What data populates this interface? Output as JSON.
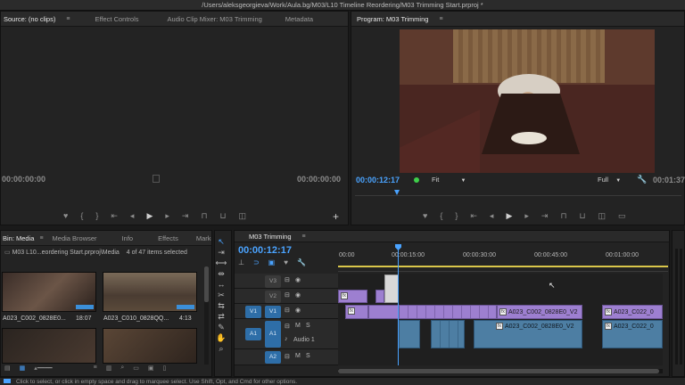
{
  "window": {
    "title": "/Users/aleksgeorgieva/Work/Aula.bg/M03/L10 Timeline Reordering/M03 Trimming Start.prproj *"
  },
  "source_panel": {
    "tabs": [
      "Source: (no clips)",
      "Effect Controls",
      "Audio Clip Mixer: M03 Trimming",
      "Metadata"
    ],
    "timecode_left": "00:00:00:00",
    "timecode_right": "00:00:00:00"
  },
  "program_panel": {
    "tab": "Program: M03 Trimming",
    "timecode": "00:00:12:17",
    "fit_label": "Fit",
    "full_label": "Full",
    "timecode_right": "00:01:37"
  },
  "project_panel": {
    "tabs": [
      "Bin: Media",
      "Media Browser",
      "Info",
      "Effects",
      "Marke"
    ],
    "path": "M03 L10...eordering Start.prproj\\Media",
    "selection_info": "4 of 47 items selected",
    "clips": [
      {
        "name": "A023_C002_0828E0...",
        "duration": "18:07"
      },
      {
        "name": "A023_C010_0828QQ...",
        "duration": "4:13"
      }
    ]
  },
  "timeline": {
    "tab": "M03 Trimming",
    "timecode": "00:00:12:17",
    "ruler": [
      "00:00",
      "00:00:15:00",
      "00:00:30:00",
      "00:00:45:00",
      "00:01:00:00"
    ],
    "tracks": [
      {
        "id": "V3",
        "target": "",
        "type": "video"
      },
      {
        "id": "V2",
        "target": "",
        "type": "video"
      },
      {
        "id": "V1",
        "target": "V1",
        "type": "video"
      },
      {
        "id": "A1",
        "target": "A1",
        "type": "audio",
        "name": "Audio 1",
        "m": "M",
        "s": "S"
      },
      {
        "id": "A2",
        "target": "",
        "type": "audio",
        "m": "M",
        "s": "S"
      }
    ],
    "clip_labels": [
      "A023_C002_0828E0_V2",
      "A023_C022_0",
      "A023_C002_0828E0_V2",
      "A023_C022_0"
    ],
    "fx_label": "fx"
  },
  "statusbar": {
    "text": "Click to select, or click in empty space and drag to marquee select. Use Shift, Opt, and Cmd for other options."
  },
  "colors": {
    "accent": "#4aa3ff",
    "video_clip": "#9d7fd0",
    "audio_clip": "#4d7ea3",
    "playhead": "#4aa3ff"
  }
}
